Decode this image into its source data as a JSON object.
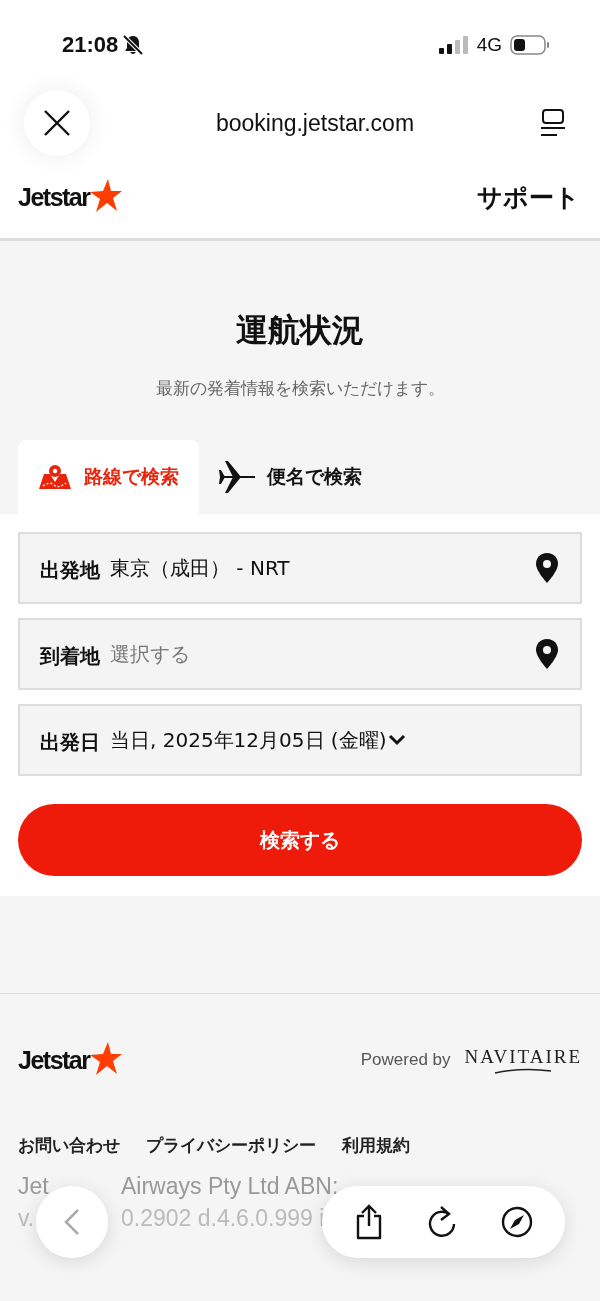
{
  "status_bar": {
    "time": "21:08",
    "network": "4G"
  },
  "browser": {
    "url": "booking.jetstar.com"
  },
  "header": {
    "logo": "Jetstar",
    "support": "サポート"
  },
  "page": {
    "title": "運航状況",
    "subtitle": "最新の発着情報を検索いただけます。"
  },
  "tabs": [
    {
      "label": "路線で検索",
      "selected": true,
      "kind": "route"
    },
    {
      "label": "便名で検索",
      "selected": false,
      "kind": "flight"
    }
  ],
  "fields": [
    {
      "label": "出発地",
      "value": "東京（成田） - NRT",
      "kind": "location"
    },
    {
      "label": "到着地",
      "placeholder": "選択する",
      "kind": "location"
    },
    {
      "label": "出発日",
      "value": "当日, 2025年12月05日 (金曜)",
      "kind": "date"
    }
  ],
  "search_button": "検索する",
  "footer": {
    "logo": "Jetstar",
    "powered_by": "Powered by",
    "vendor": "NAVITAIRE",
    "links": [
      "お問い合わせ",
      "プライバシーポリシー",
      "利用規約"
    ],
    "legal_lines": [
      [
        "Jet",
        "Airways Pty Ltd ABN:"
      ],
      [
        "v.",
        "0.2902 d.4.6.0.999 i"
      ]
    ]
  }
}
